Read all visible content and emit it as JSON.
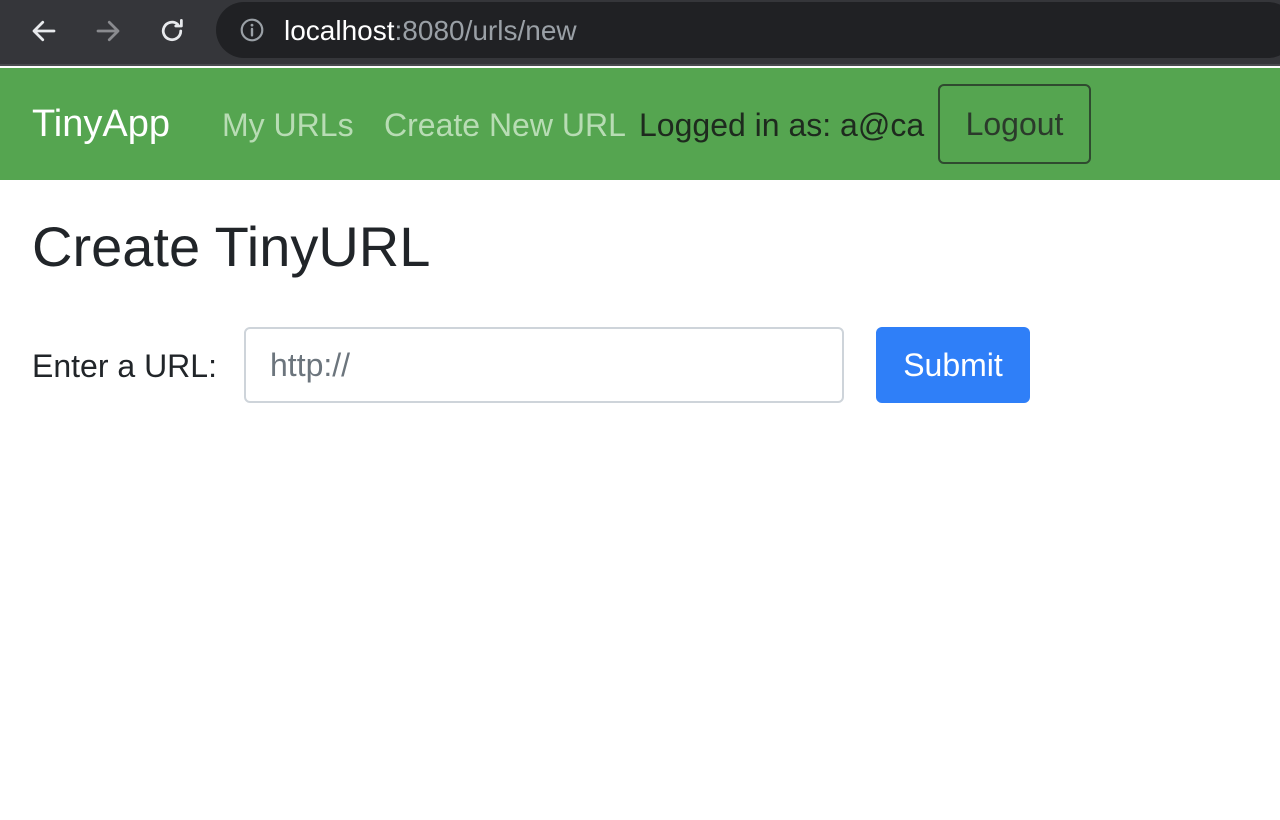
{
  "browser": {
    "url_host": "localhost",
    "url_rest": ":8080/urls/new",
    "icons": {
      "back": "arrow-left",
      "forward": "arrow-right",
      "reload": "reload",
      "site_info": "info-circle"
    }
  },
  "navbar": {
    "brand": "TinyApp",
    "links": {
      "my_urls": "My URLs",
      "create_new": "Create New URL"
    },
    "logged_in_text": "Logged in as: a@ca",
    "logout_label": "Logout",
    "colors": {
      "background": "#55a550",
      "link": "#b8dcb4"
    }
  },
  "main": {
    "title": "Create TinyURL",
    "form": {
      "label": "Enter a URL:",
      "input_placeholder": "http://",
      "input_value": "",
      "submit_label": "Submit"
    },
    "colors": {
      "primary_button": "#2f7ff8"
    }
  }
}
